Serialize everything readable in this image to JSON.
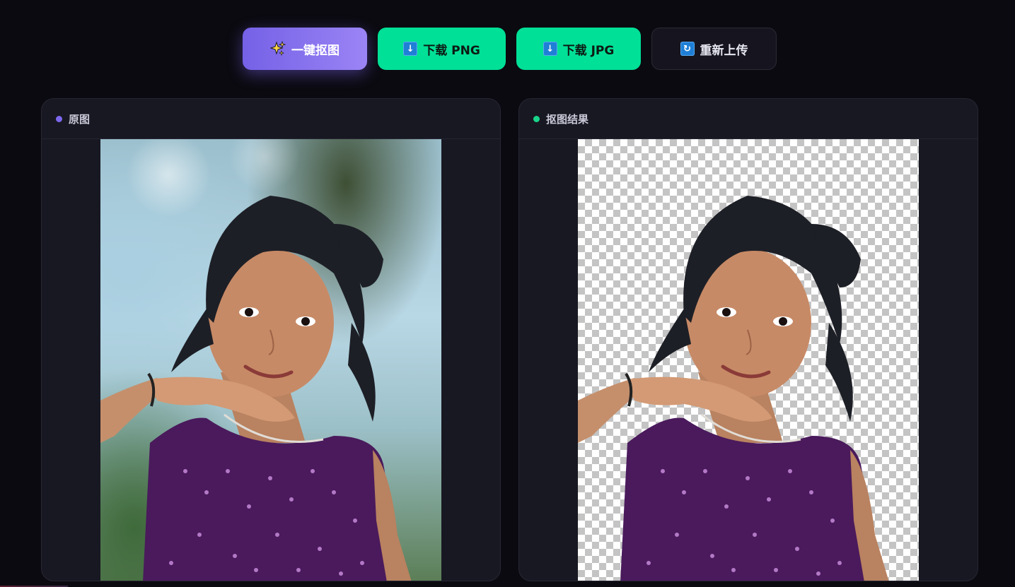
{
  "toolbar": {
    "cutout_label": "一键抠图",
    "cutout_icon": "sparkles-icon",
    "download_png_label": "下载 PNG",
    "download_png_icon": "download-arrow-icon",
    "download_jpg_label": "下载 JPG",
    "download_jpg_icon": "download-arrow-icon",
    "reupload_label": "重新上传",
    "reupload_icon": "refresh-icon"
  },
  "panels": {
    "original": {
      "title": "原图",
      "dot_color": "#7b68ee"
    },
    "result": {
      "title": "抠图结果",
      "dot_color": "#19d48a"
    }
  },
  "colors": {
    "accent_purple": "#7b68ee",
    "accent_green": "#00e096",
    "background": "#0b0a10",
    "panel": "#181822"
  }
}
